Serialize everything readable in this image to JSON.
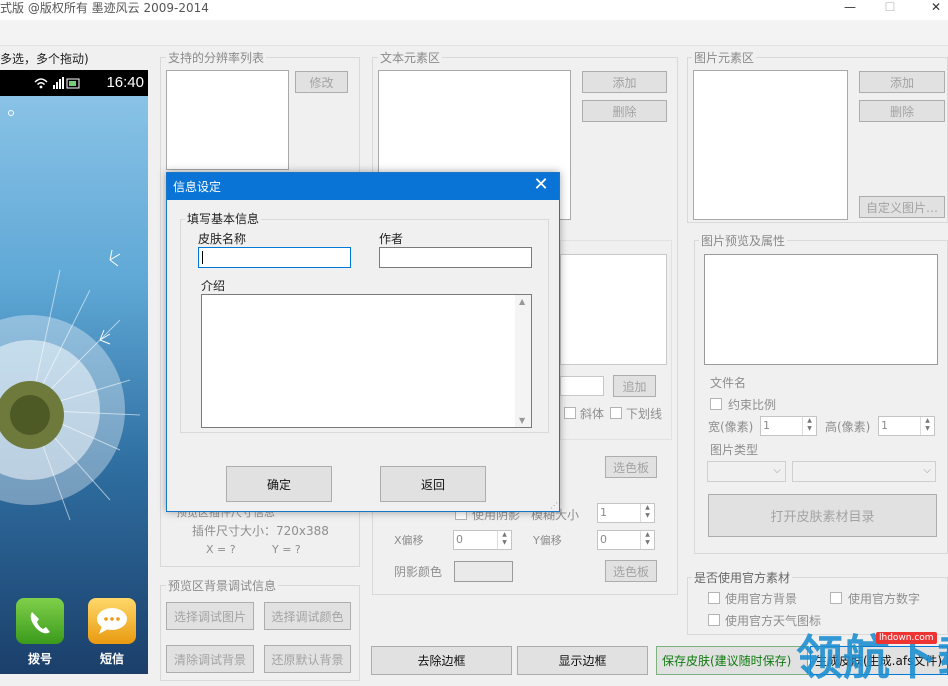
{
  "window": {
    "title": "式版 @版权所有 墨迹风云 2009-2014",
    "minimize": "—",
    "maximize": "☐",
    "close": "✕"
  },
  "left_caption": "多选，多个拖动)",
  "phone": {
    "time": "16:40",
    "dock": [
      {
        "label": "拨号",
        "icon": "phone-icon"
      },
      {
        "label": "短信",
        "icon": "message-icon"
      }
    ]
  },
  "resolution_panel": {
    "legend": "支持的分辨率列表",
    "modify": "修改"
  },
  "text_panel": {
    "legend": "文本元素区",
    "add": "添加",
    "delete": "删除",
    "add2": "追加",
    "italic": "斜体",
    "underline": "下划线",
    "color_select": "选色板",
    "shadow": "使用阴影",
    "blur_size": "模糊大小",
    "blur_value": "1",
    "x_offset": "X偏移",
    "x_value": "0",
    "y_offset": "Y偏移",
    "y_value": "0",
    "shadow_color": "阴影颜色",
    "shadow_color_select": "选色板"
  },
  "plugin_panel": {
    "partial": "预览区插件尺寸信息",
    "size": "插件尺寸大小：720x388",
    "x": "X = ?",
    "y": "Y = ?"
  },
  "bg_debug_panel": {
    "legend": "预览区背景调试信息",
    "select_image": "选择调试图片",
    "select_color": "选择调试颜色",
    "clear_bg": "清除调试背景",
    "restore_bg": "还原默认背景"
  },
  "image_panel": {
    "legend": "图片元素区",
    "add": "添加",
    "delete": "删除",
    "custom": "自定义图片…"
  },
  "preview_panel": {
    "legend": "图片预览及属性",
    "filename": "文件名",
    "constrain": "约束比例",
    "width": "宽(像素)",
    "width_value": "1",
    "height": "高(像素)",
    "height_value": "1",
    "type": "图片类型",
    "open_dir": "打开皮肤素材目录"
  },
  "official_panel": {
    "legend": "是否使用官方素材",
    "use_bg": "使用官方背景",
    "use_digits": "使用官方数字",
    "use_weather": "使用官方天气图标"
  },
  "bottom": {
    "remove_border": "去除边框",
    "show_border": "显示边框",
    "save": "保存皮肤(建议随时保存)",
    "generate": "生成皮肤(生成.afs文件)"
  },
  "dialog": {
    "title": "信息设定",
    "group": "填写基本信息",
    "skin_name_label": "皮肤名称",
    "skin_name_value": "",
    "author_label": "作者",
    "author_value": "",
    "intro_label": "介绍",
    "intro_value": "",
    "ok": "确定",
    "back": "返回"
  },
  "watermark": {
    "text": "领航下载",
    "site": "lhdown.com"
  },
  "colors": {
    "dialog_title": "#0a74d6",
    "focus_border": "#0078d7",
    "save_text": "#0f7a0f"
  }
}
